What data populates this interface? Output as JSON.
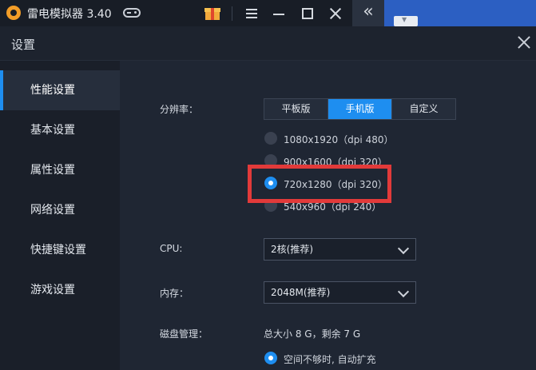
{
  "titlebar": {
    "app_title": "雷电模拟器 3.40"
  },
  "dialog": {
    "title": "设置"
  },
  "sidebar": {
    "items": [
      {
        "label": "性能设置",
        "active": true
      },
      {
        "label": "基本设置",
        "active": false
      },
      {
        "label": "属性设置",
        "active": false
      },
      {
        "label": "网络设置",
        "active": false
      },
      {
        "label": "快捷键设置",
        "active": false
      },
      {
        "label": "游戏设置",
        "active": false
      }
    ]
  },
  "performance": {
    "resolution_label": "分辨率：",
    "device_tabs": [
      "平板版",
      "手机版",
      "自定义"
    ],
    "selected_tab": "手机版",
    "resolutions": [
      {
        "label": "1080x1920（dpi 480）",
        "checked": false
      },
      {
        "label": "900x1600（dpi 320）",
        "checked": false
      },
      {
        "label": "720x1280（dpi 320）",
        "checked": true
      },
      {
        "label": "540x960（dpi 240）",
        "checked": false
      }
    ],
    "cpu_label": "CPU:",
    "cpu_value": "2核(推荐)",
    "memory_label": "内存：",
    "memory_value": "2048M(推荐)",
    "disk_label": "磁盘管理：",
    "disk_info": "总大小 8 G，剩余 7 G",
    "disk_option": "空间不够时, 自动扩充"
  },
  "colors": {
    "accent": "#1e8ef0",
    "highlight": "#e23a3a",
    "background": "#1f2633",
    "sidebar": "#1a1f29"
  }
}
